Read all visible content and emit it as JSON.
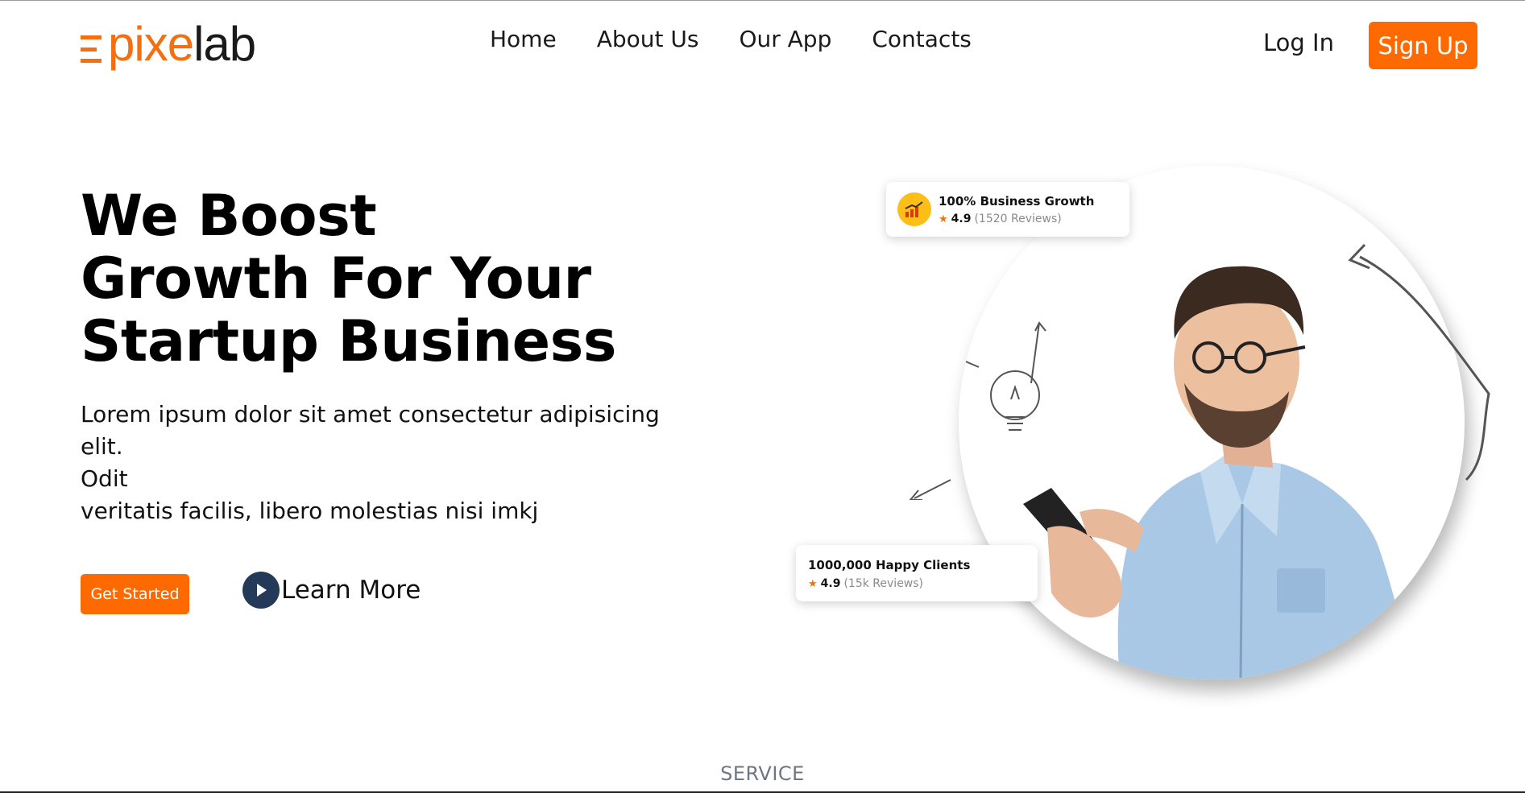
{
  "brand": {
    "logo_colored": "pixe",
    "logo_dark": "lab",
    "accent": "#ff6a00"
  },
  "nav": {
    "items": [
      "Home",
      "About Us",
      "Our App",
      "Contacts"
    ]
  },
  "auth": {
    "login": "Log In",
    "signup": "Sign Up"
  },
  "hero": {
    "title_lines": [
      "We Boost",
      "Growth For Your",
      "Startup Business"
    ],
    "desc_lines": [
      "Lorem ipsum dolor sit amet consectetur adipisicing elit.",
      "Odit",
      "veritatis facilis, libero molestias nisi imkj"
    ],
    "cta_primary": "Get Started",
    "cta_secondary": "Learn More"
  },
  "stats": [
    {
      "title": "100% Business Growth",
      "score": "4.9",
      "reviews": "(1520 Reviews)",
      "icon": "growth-chart-icon"
    },
    {
      "title": "1000,000 Happy Clients",
      "score": "4.9",
      "reviews": "(15k Reviews)"
    }
  ],
  "section": {
    "next_label": "SERVICE"
  }
}
